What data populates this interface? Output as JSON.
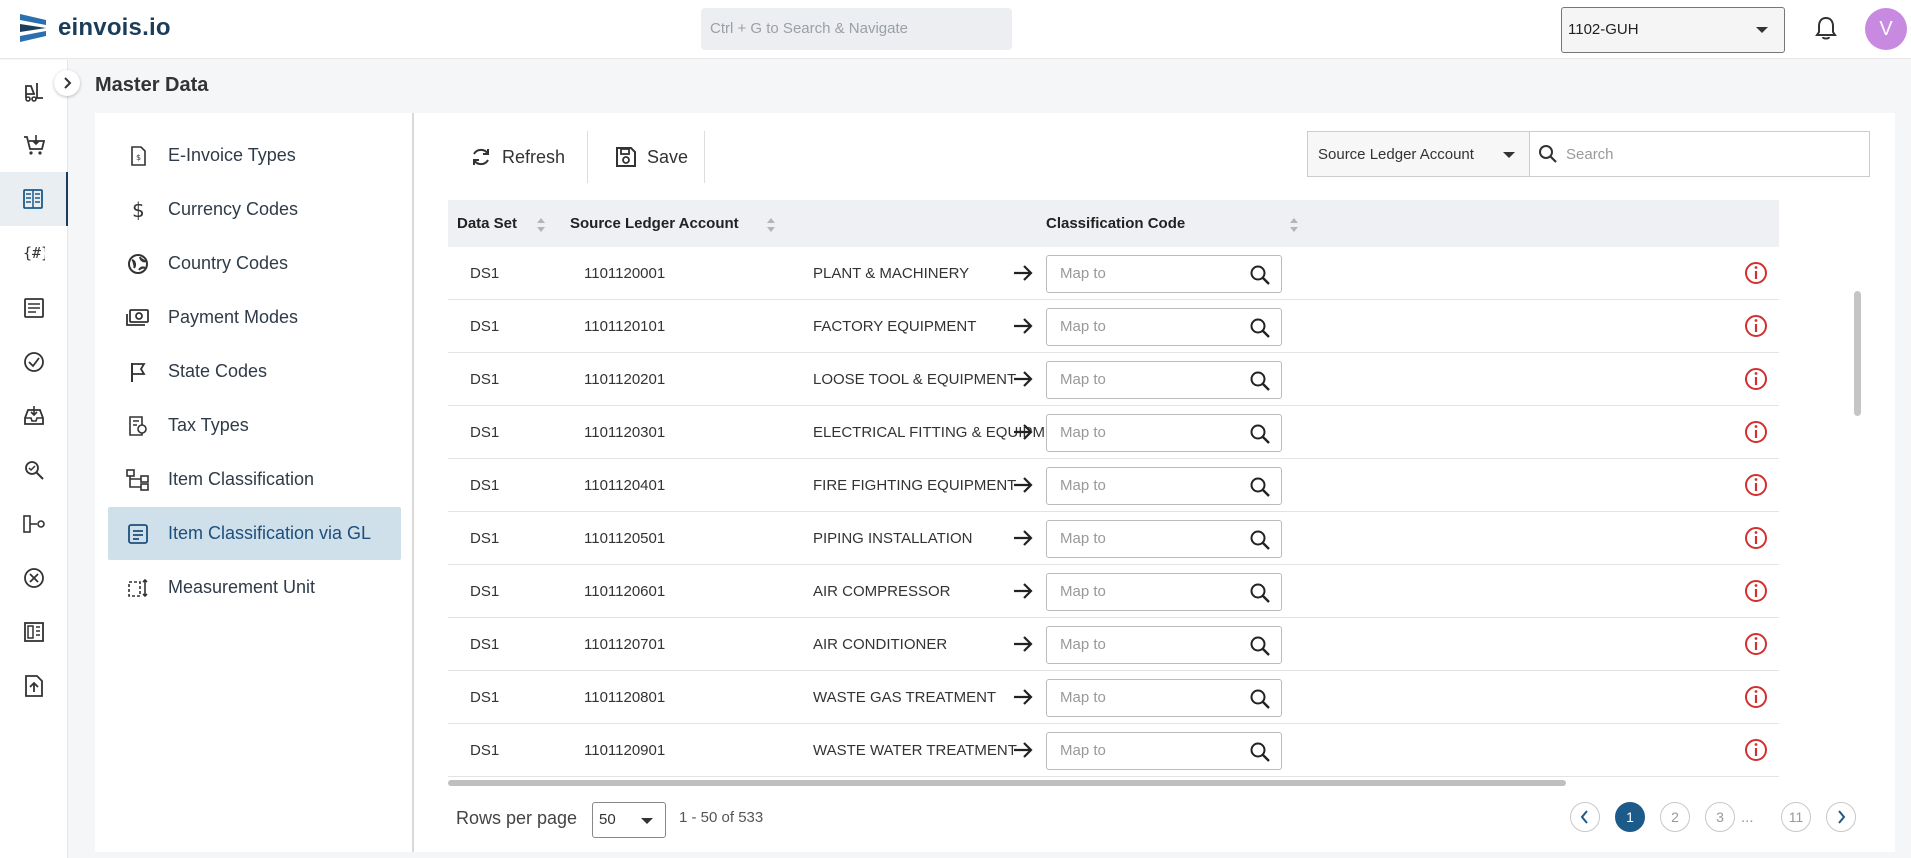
{
  "app": {
    "brand": "einvois.io"
  },
  "header": {
    "search_placeholder": "Ctrl + G to Search & Navigate",
    "org_selected": "1102-GUH",
    "avatar_initial": "V"
  },
  "rail_icons": [
    "forklift-icon",
    "cart-icon",
    "ledger-icon",
    "hash-code-icon",
    "list-doc-icon",
    "check-circle-icon",
    "inbox-tray-icon",
    "search-doc-icon",
    "flow-icon",
    "cancel-circle-icon",
    "layout-icon",
    "upload-doc-icon"
  ],
  "page": {
    "title": "Master Data"
  },
  "menu": {
    "items": [
      {
        "label": "E-Invoice Types",
        "icon": "invoice-icon"
      },
      {
        "label": "Currency Codes",
        "icon": "dollar-icon"
      },
      {
        "label": "Country Codes",
        "icon": "globe-icon"
      },
      {
        "label": "Payment Modes",
        "icon": "money-icon"
      },
      {
        "label": "State Codes",
        "icon": "flag-icon"
      },
      {
        "label": "Tax Types",
        "icon": "tax-doc-icon"
      },
      {
        "label": "Item Classification",
        "icon": "hierarchy-icon"
      },
      {
        "label": "Item Classification via GL",
        "icon": "gl-doc-icon"
      },
      {
        "label": "Measurement Unit",
        "icon": "measure-icon"
      }
    ],
    "active_index": 7
  },
  "toolbar": {
    "refresh_label": "Refresh",
    "save_label": "Save"
  },
  "filter": {
    "field_selected": "Source Ledger Account",
    "search_placeholder": "Search"
  },
  "table": {
    "columns": [
      "Data Set",
      "Source Ledger Account",
      "Classification Code"
    ],
    "map_placeholder": "Map to",
    "rows": [
      {
        "dataset": "DS1",
        "account": "1101120001",
        "description": "PLANT & MACHINERY"
      },
      {
        "dataset": "DS1",
        "account": "1101120101",
        "description": "FACTORY EQUIPMENT"
      },
      {
        "dataset": "DS1",
        "account": "1101120201",
        "description": "LOOSE TOOL & EQUIPMENT"
      },
      {
        "dataset": "DS1",
        "account": "1101120301",
        "description": "ELECTRICAL FITTING & EQUIPMEN"
      },
      {
        "dataset": "DS1",
        "account": "1101120401",
        "description": "FIRE FIGHTING EQUIPMENT"
      },
      {
        "dataset": "DS1",
        "account": "1101120501",
        "description": "PIPING INSTALLATION"
      },
      {
        "dataset": "DS1",
        "account": "1101120601",
        "description": "AIR COMPRESSOR"
      },
      {
        "dataset": "DS1",
        "account": "1101120701",
        "description": "AIR CONDITIONER"
      },
      {
        "dataset": "DS1",
        "account": "1101120801",
        "description": "WASTE GAS TREATMENT"
      },
      {
        "dataset": "DS1",
        "account": "1101120901",
        "description": "WASTE WATER TREATMENT"
      }
    ]
  },
  "pagination": {
    "rows_per_page_label": "Rows per page",
    "rows_per_page": "50",
    "range": "1 - 50 of 533",
    "pages": [
      "1",
      "2",
      "3",
      "11"
    ],
    "ellipsis": "...",
    "current": "1"
  },
  "colors": {
    "brand": "#1c3d5a",
    "accent": "#1c5a8a",
    "active_menu": "#cfe0ea",
    "info_red": "#d32f2f",
    "avatar": "#c78ae0"
  }
}
